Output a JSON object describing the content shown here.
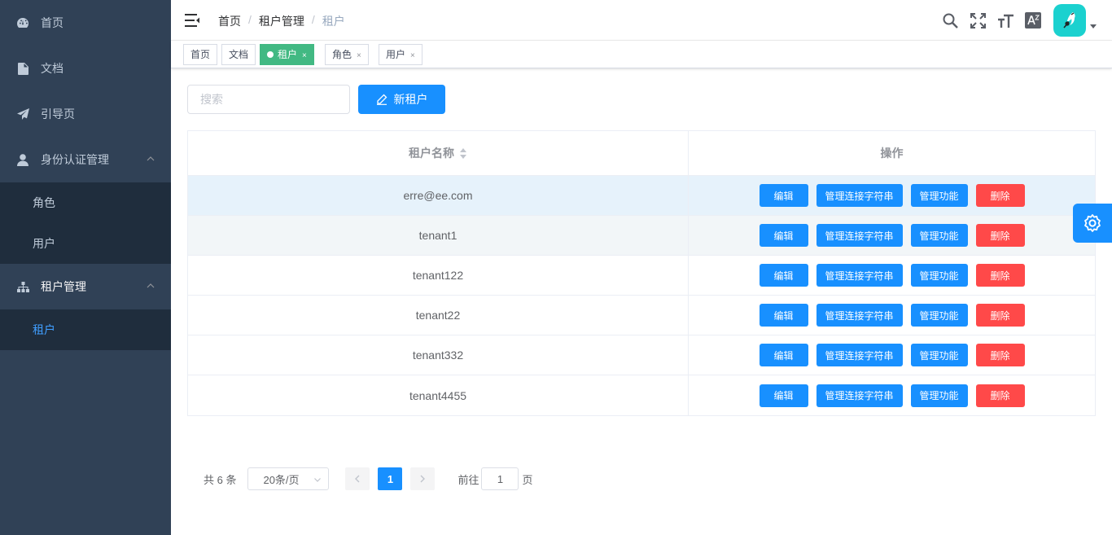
{
  "sidebar": {
    "items": [
      {
        "label": "首页",
        "icon": "dashboard-icon"
      },
      {
        "label": "文档",
        "icon": "document-icon"
      },
      {
        "label": "引导页",
        "icon": "guide-icon"
      },
      {
        "label": "身份认证管理",
        "icon": "user-icon"
      },
      {
        "label": "角色"
      },
      {
        "label": "用户"
      },
      {
        "label": "租户管理",
        "icon": "tree-icon"
      },
      {
        "label": "租户"
      }
    ]
  },
  "navbar": {
    "breadcrumb": [
      "首页",
      "租户管理",
      "租户"
    ],
    "separator": "/"
  },
  "tags": [
    {
      "label": "首页"
    },
    {
      "label": "文档"
    },
    {
      "label": "租户",
      "close": "×"
    },
    {
      "label": "角色",
      "close": "×"
    },
    {
      "label": "用户",
      "close": "×"
    }
  ],
  "toolbar": {
    "search_placeholder": "搜索",
    "new_label": "新租户"
  },
  "table": {
    "headers": [
      "租户名称",
      "操作"
    ],
    "actions": [
      "编辑",
      "管理连接字符串",
      "管理功能",
      "删除"
    ],
    "rows": [
      "erre@ee.com",
      "tenant1",
      "tenant122",
      "tenant22",
      "tenant332",
      "tenant4455"
    ]
  },
  "pagination": {
    "total": "共 6 条",
    "page_size": "20条/页",
    "current_page": "1",
    "goto_prefix": "前往",
    "goto_value": "1",
    "goto_suffix": "页"
  },
  "colors": {
    "sidebar_bg": "#304156",
    "primary": "#1890ff",
    "danger": "#ff4949",
    "active_tag": "#42b983",
    "avatar_bg": "#1bd1cf"
  }
}
